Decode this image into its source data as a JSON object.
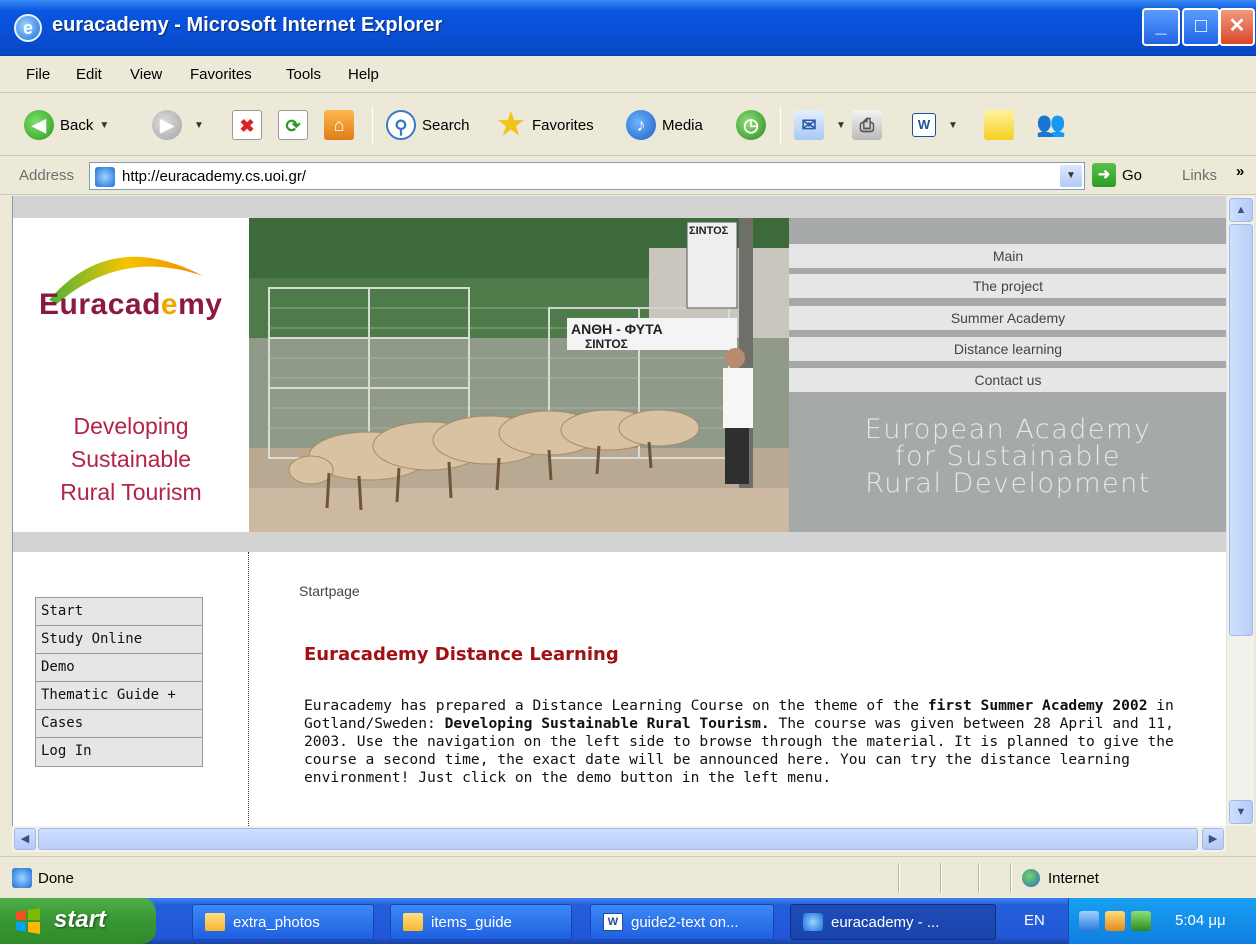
{
  "window": {
    "title": "euracademy - Microsoft Internet Explorer",
    "controls": {
      "min": "_",
      "max": "□",
      "close": "✕"
    }
  },
  "menubar": [
    "File",
    "Edit",
    "View",
    "Favorites",
    "Tools",
    "Help"
  ],
  "toolbar": {
    "back": "Back",
    "search": "Search",
    "favorites": "Favorites",
    "media": "Media"
  },
  "address": {
    "label": "Address",
    "url": "http://euracademy.cs.uoi.gr/",
    "go": "Go",
    "links": "Links",
    "links_more": "»"
  },
  "page": {
    "logo": "Euracademy",
    "tagline": [
      "Developing",
      "Sustainable",
      "Rural Tourism"
    ],
    "nav": [
      "Main",
      "The project",
      "Summer Academy",
      "Distance learning",
      "Contact us"
    ],
    "slogan": [
      "European Academy",
      "for Sustainable",
      "Rural Development"
    ],
    "photo_signs": [
      "ΣΙΝΤΟΣ",
      "ΑΝΘΗ - ΦΥΤΑ",
      "ΣΙΝΤΟΣ"
    ],
    "left_menu": [
      "Start",
      "Study Online",
      "Demo",
      "Thematic Guide +",
      "Cases",
      "Log In"
    ],
    "breadcrumb": "Startpage",
    "heading": "Euracademy Distance Learning",
    "paragraph": {
      "p1": "Euracademy has prepared a Distance Learning Course on the theme of the ",
      "b1": "first Summer Academy 2002",
      "p2": " in Gotland/Sweden: ",
      "b2": "Developing Sustainable Rural Tourism.",
      "p3": " The course was given between 28 April and 11, 2003. Use the navigation on the left side to browse through the material. It is planned to give the course a second time, the exact date will be announced here. You can try the distance learning environment! Just click on the demo button in the left menu."
    }
  },
  "status": {
    "text": "Done",
    "zone": "Internet"
  },
  "taskbar": {
    "start": "start",
    "tasks": [
      "extra_photos",
      "items_guide",
      "guide2-text on...",
      "euracademy - ..."
    ],
    "language": "EN",
    "clock": "5:04 μμ"
  }
}
